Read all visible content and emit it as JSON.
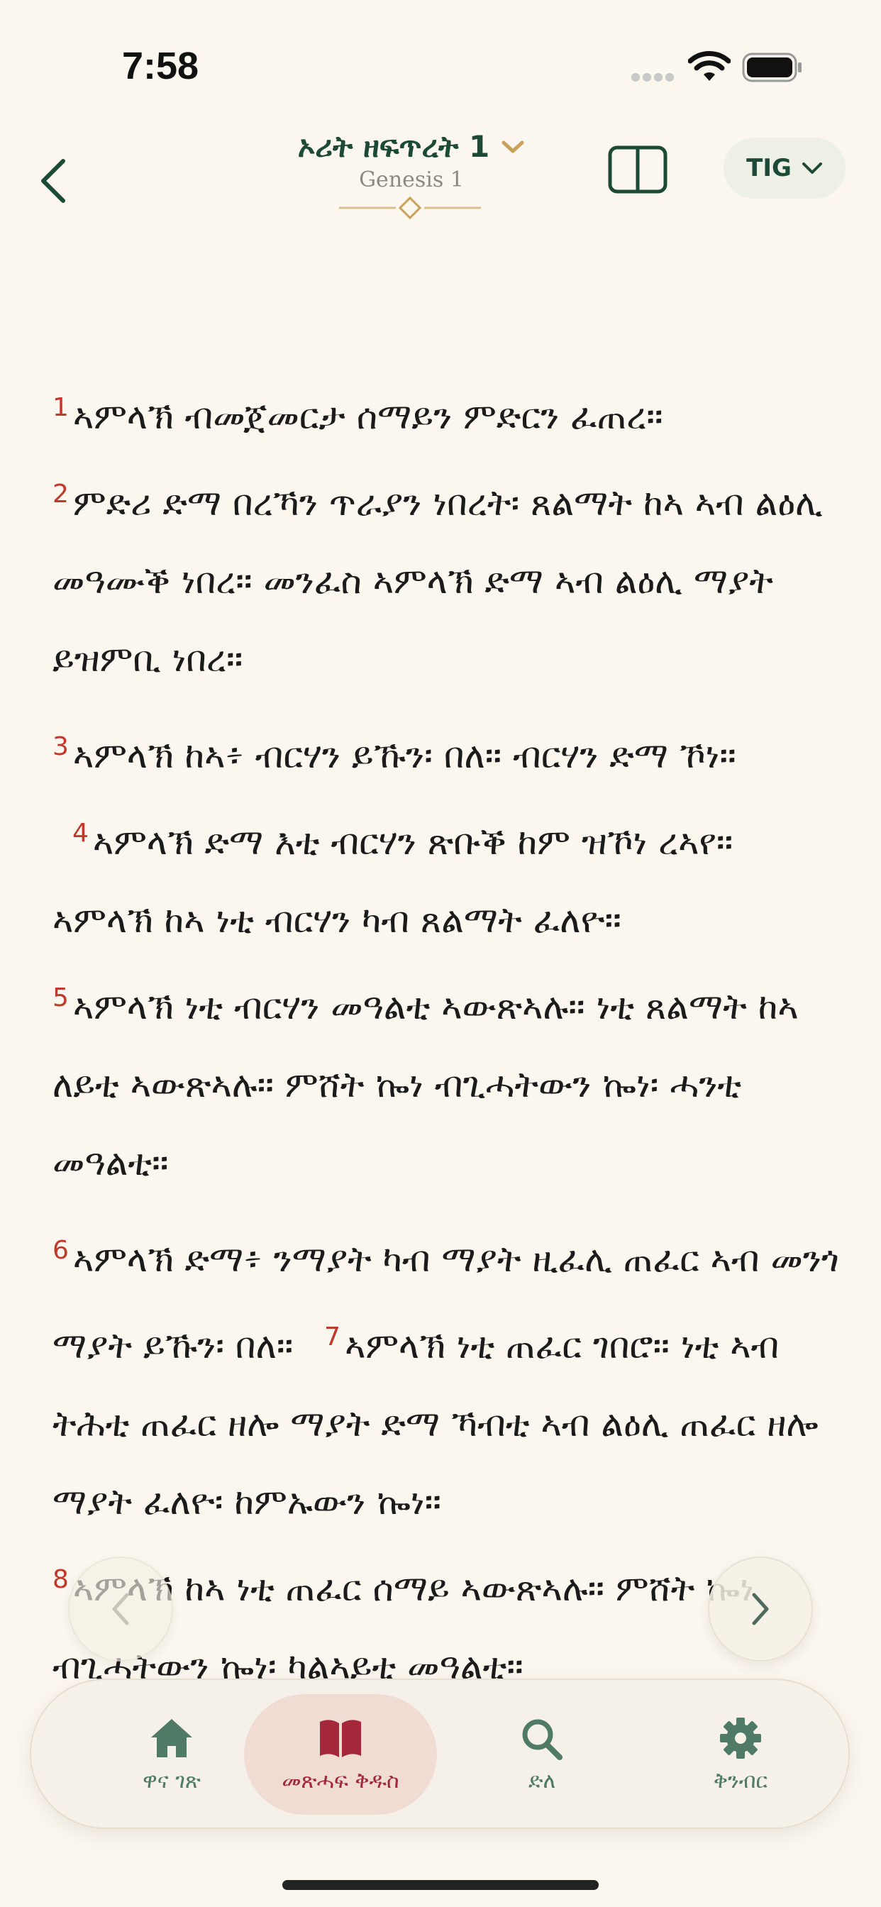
{
  "status_bar": {
    "time": "7:58"
  },
  "header": {
    "book_title": "ኦሪት ዘፍጥረት 1",
    "subtitle": "Genesis 1",
    "language": "TIG"
  },
  "colors": {
    "background": "#FCF7EE",
    "accent_green": "#1d4a36",
    "verse_number": "#c0392b",
    "active_tab": "#a3293a",
    "gold": "#c9a15a"
  },
  "scripture": {
    "paragraphs": [
      {
        "verses": [
          {
            "num": "1",
            "text": "ኣምላኽ ብመጀመርታ ሰማይን ምድርን ፈጠረ።"
          },
          {
            "num": "2",
            "text": "ምድሪ ድማ በረኻን ጥራያን ነበረት፡ ጸልማት ከኣ ኣብ ልዕሊ መዓሙቕ ነበረ። መንፈስ ኣምላኽ ድማ ኣብ ልዕሊ ማያት ይዝምቢ ነበረ።"
          }
        ]
      },
      {
        "verses": [
          {
            "num": "3",
            "text": "ኣምላኽ ከኣ፥ ብርሃን ይኹን፡ በለ። ብርሃን ድማ ኾነ።"
          },
          {
            "num": "4",
            "text": "ኣምላኽ ድማ እቲ ብርሃን ጽቡቕ ከም ዝኾነ ረኣየ። ኣምላኽ ከኣ ነቲ ብርሃን ካብ ጸልማት ፈለዮ።"
          },
          {
            "num": "5",
            "text": "ኣምላኽ ነቲ ብርሃን መዓልቲ ኣውጽኣሉ። ነቲ ጸልማት ከኣ ለይቲ ኣውጽኣሉ። ምሸት ኰነ ብጊሓትውን ኰነ፡ ሓንቲ መዓልቲ።"
          }
        ]
      },
      {
        "verses": [
          {
            "num": "6",
            "text": "ኣምላኽ ድማ፥ ንማያት ካብ ማያት ዚፈሊ ጠፈር ኣብ መንጎ ማያት ይኹን፡ በለ።"
          },
          {
            "num": "7",
            "text": "ኣምላኽ ነቲ ጠፈር ገበሮ። ነቲ ኣብ ትሕቲ ጠፈር ዘሎ ማያት ድማ ኻብቲ ኣብ ልዕሊ ጠፈር ዘሎ ማያት ፈለዮ፡ ከምኡውን ኰነ።"
          },
          {
            "num": "8",
            "text": "ኣምላኽ ከኣ ነቲ ጠፈር ሰማይ ኣውጽኣሉ። ምሸት ኰነ ብጊሓትውን ኰነ፡ ካልኣይቲ መዓልቲ።"
          }
        ]
      }
    ]
  },
  "tabs": [
    {
      "label": "ዋና ገጽ"
    },
    {
      "label": "መጽሓፍ ቅዱስ"
    },
    {
      "label": "ድለ"
    },
    {
      "label": "ቅንብር"
    }
  ]
}
